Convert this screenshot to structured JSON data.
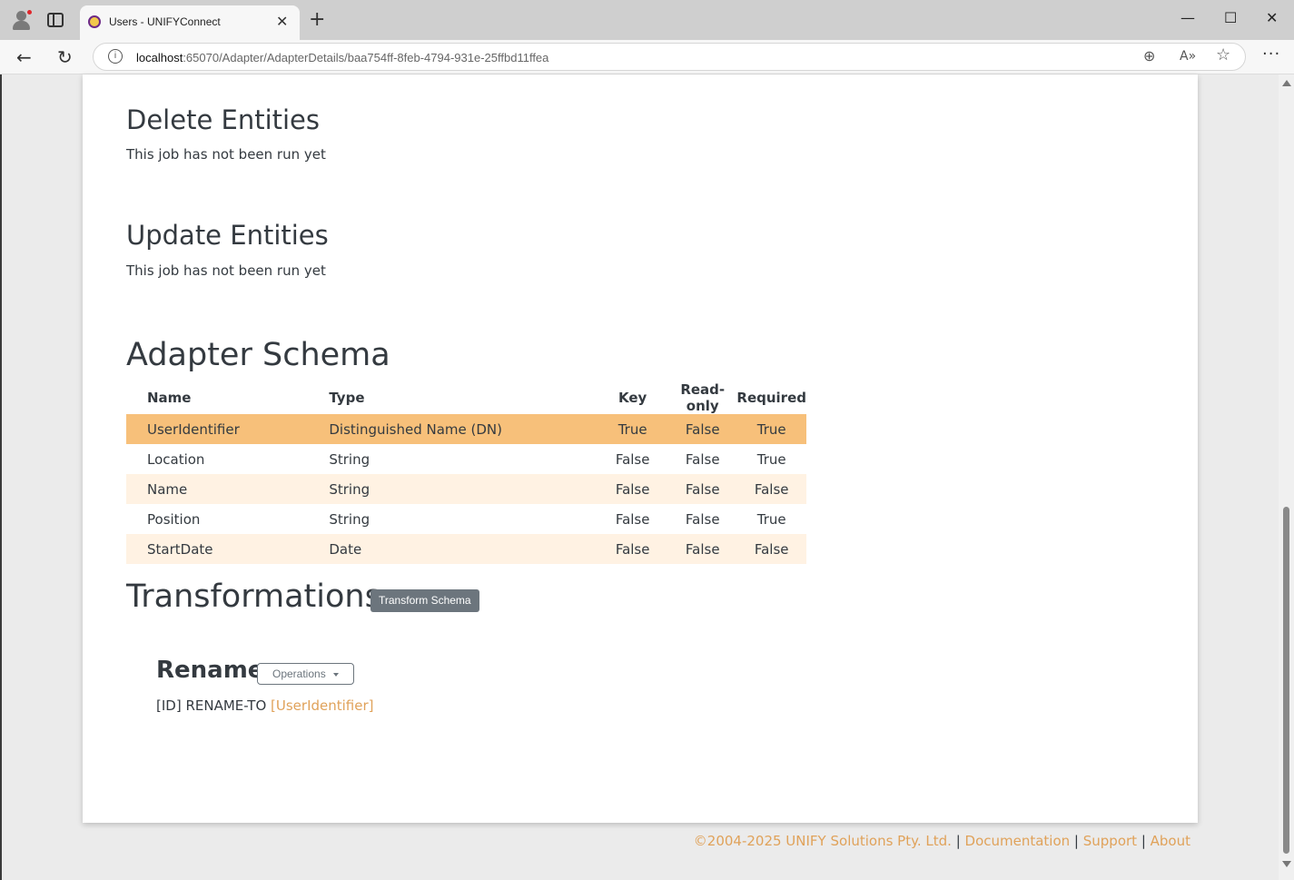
{
  "browser": {
    "tab_title": "Users - UNIFYConnect",
    "url_host": "localhost",
    "url_rest": ":65070/Adapter/AdapterDetails/baa754ff-8feb-4794-931e-25ffbd11ffea"
  },
  "jobs": [
    {
      "title": "Delete Entities",
      "status": "This job has not been run yet"
    },
    {
      "title": "Update Entities",
      "status": "This job has not been run yet"
    }
  ],
  "schema": {
    "title": "Adapter Schema",
    "columns": [
      "Name",
      "Type",
      "Key",
      "Read-only",
      "Required"
    ],
    "rows": [
      [
        "UserIdentifier",
        "Distinguished Name (DN)",
        "True",
        "False",
        "True"
      ],
      [
        "Location",
        "String",
        "False",
        "False",
        "True"
      ],
      [
        "Name",
        "String",
        "False",
        "False",
        "False"
      ],
      [
        "Position",
        "String",
        "False",
        "False",
        "True"
      ],
      [
        "StartDate",
        "Date",
        "False",
        "False",
        "False"
      ]
    ]
  },
  "transformations": {
    "title": "Transformations",
    "button_label": "Transform Schema",
    "rename_title": "Rename",
    "operations_label": "Operations",
    "rule_prefix": "[ID] RENAME-TO ",
    "rule_target": "[UserIdentifier]"
  },
  "footer": {
    "copyright": "©2004-2025 UNIFY Solutions Pty. Ltd.",
    "sep1": " | ",
    "documentation": "Documentation",
    "sep2": " | ",
    "support": "Support",
    "sep3": " | ",
    "about": "About"
  },
  "colors": {
    "accent": "#e0a25a",
    "selected_row": "#f7c07a",
    "alt_row": "#fff2e3"
  }
}
